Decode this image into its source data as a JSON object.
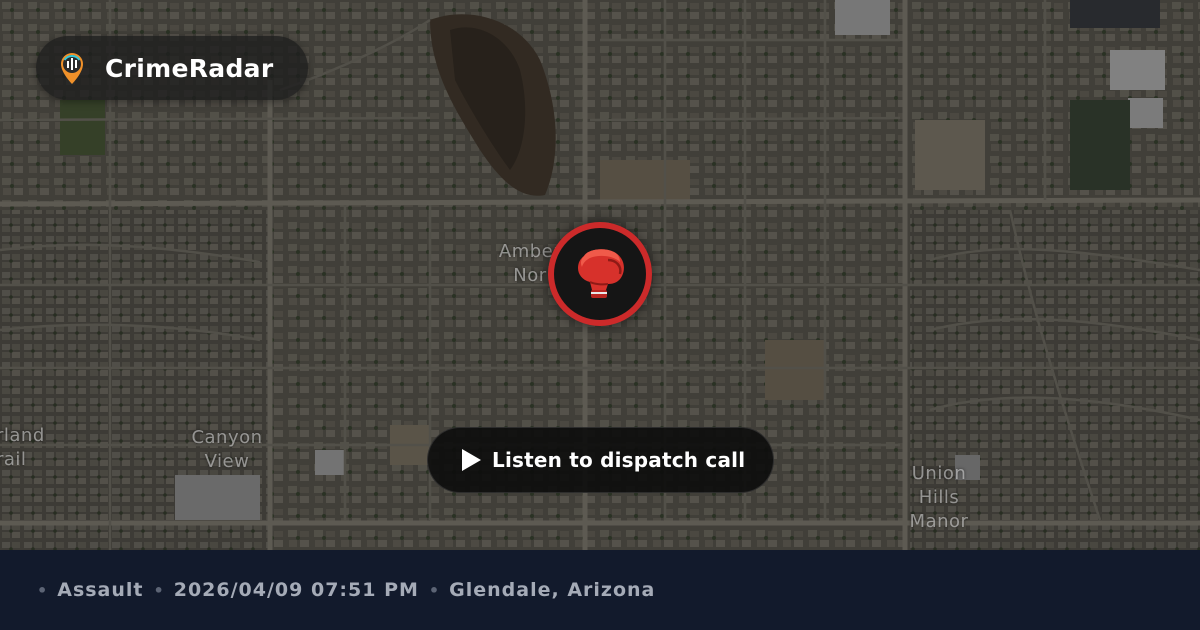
{
  "brand": {
    "name": "CrimeRadar",
    "logo_icon": "radar-pin-icon"
  },
  "map": {
    "labels": {
      "amber": "Amber",
      "amber_line2": "Nor",
      "canyon": "Canyon View",
      "rland": "rland",
      "rland_line2": "rail",
      "union": "Union",
      "union_line2": "Hills",
      "union_line3": "Manor"
    }
  },
  "marker": {
    "icon": "boxing-glove-icon",
    "ring_color": "#cc2a2a"
  },
  "dispatch": {
    "label": "Listen to dispatch call",
    "icon": "play-icon"
  },
  "footer": {
    "crime_type": "Assault",
    "datetime": "2026/04/09 07:51 PM",
    "location": "Glendale, Arizona",
    "separator": "•"
  }
}
